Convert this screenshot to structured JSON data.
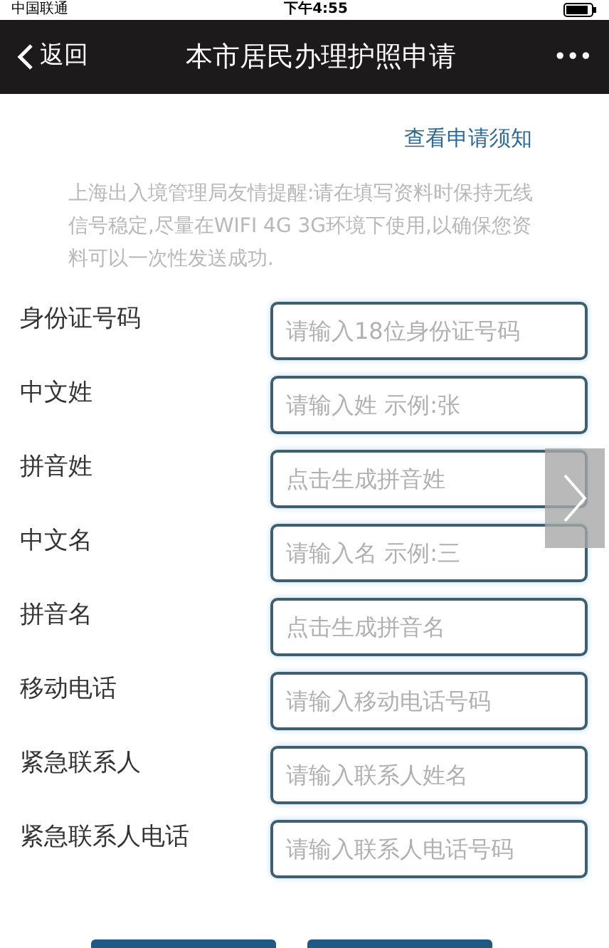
{
  "status_bar": {
    "carrier": "中国联通",
    "time": "下午4:55"
  },
  "nav": {
    "back": "返回",
    "title": "本市居民办理护照申请",
    "more": "•••"
  },
  "notice_link": "查看申请须知",
  "notice": "上海出入境管理局友情提醒:请在填写资料时保持无线信号稳定,尽量在WIFI 4G 3G环境下使用,以确保您资料可以一次性发送成功.",
  "fields": [
    {
      "label": "身份证号码",
      "placeholder": "请输入18位身份证号码"
    },
    {
      "label": "中文姓",
      "placeholder": "请输入姓 示例:张"
    },
    {
      "label": "拼音姓",
      "placeholder": "点击生成拼音姓"
    },
    {
      "label": "中文名",
      "placeholder": "请输入名 示例:三"
    },
    {
      "label": "拼音名",
      "placeholder": "点击生成拼音名"
    },
    {
      "label": "移动电话",
      "placeholder": "请输入移动电话号码"
    },
    {
      "label": "紧急联系人",
      "placeholder": "请输入联系人姓名"
    },
    {
      "label": "紧急联系人电话",
      "placeholder": "请输入联系人电话号码"
    }
  ],
  "buttons": [
    {
      "kind": "primary"
    },
    {
      "kind": "primary"
    }
  ]
}
